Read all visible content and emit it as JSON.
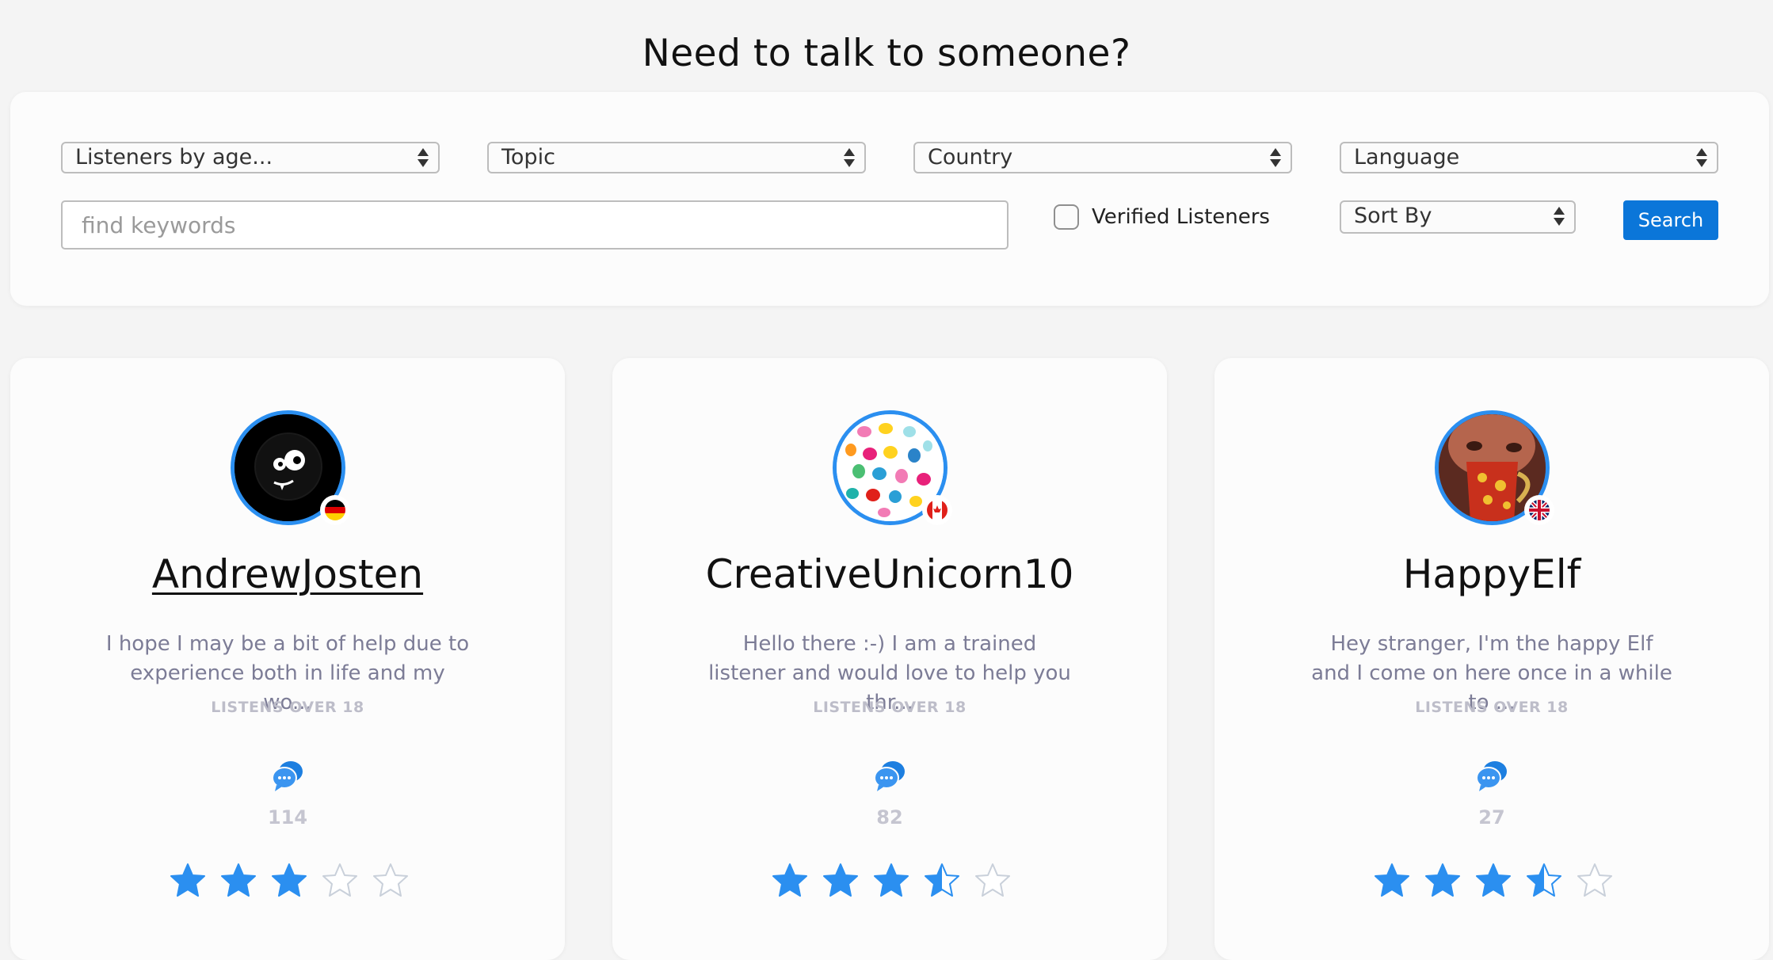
{
  "page": {
    "title": "Need to talk to someone?"
  },
  "filters": {
    "age": "Listeners by age...",
    "topic": "Topic",
    "country": "Country",
    "language": "Language",
    "keywords_placeholder": "find keywords",
    "verified_label": "Verified Listeners",
    "verified_checked": false,
    "sort_by": "Sort By",
    "search_label": "Search"
  },
  "colors": {
    "accent": "#0b76d9",
    "star": "#2b8ff0",
    "star_empty": "#c9d0da",
    "ring": "#2b8ff0"
  },
  "listeners": [
    {
      "name": "AndrewJosten",
      "bio": "I hope I may be a bit of help due to experience both in life and my wo...",
      "age_group": "LISTENS OVER 18",
      "chats": "114",
      "rating": 3,
      "flag": "germany-flag-icon",
      "avatar": "black-monster-avatar"
    },
    {
      "name": "CreativeUnicorn10",
      "bio": "Hello there :-) I am a trained listener and would love to help you thr...",
      "age_group": "LISTENS OVER 18",
      "chats": "82",
      "rating": 3.5,
      "flag": "canada-flag-icon",
      "avatar": "colorful-hands-avatar"
    },
    {
      "name": "HappyElf",
      "bio": "Hey stranger, I'm the happy Elf and I come on here once in a while to ...",
      "age_group": "LISTENS OVER 18",
      "chats": "27",
      "rating": 3.5,
      "flag": "uk-flag-icon",
      "avatar": "photo-mug-avatar"
    }
  ]
}
